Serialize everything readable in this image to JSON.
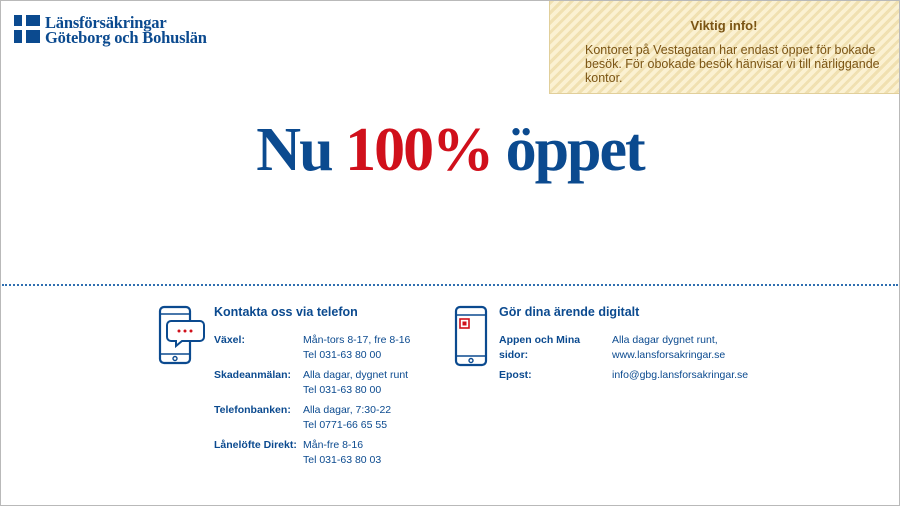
{
  "logo": {
    "line1": "Länsförsäkringar",
    "line2": "Göteborg och Bohuslän",
    "colors": {
      "blue": "#0b4a8f",
      "white": "#ffffff"
    }
  },
  "info": {
    "title": "Viktig info!",
    "body": "Kontoret på Vestagatan har endast öppet för bokade besök. För obokade besök hänvisar vi till närliggande kontor."
  },
  "headline": {
    "part1": "Nu ",
    "part2": "100%",
    "part3": " öppet",
    "colors": {
      "blue": "#0b4a8f",
      "red": "#d0101b"
    }
  },
  "phone_contact": {
    "title": "Kontakta oss via telefon",
    "icon": "phone-chat-icon",
    "rows": [
      {
        "label": "Växel:",
        "line1": "Mån-tors 8-17, fre 8-16",
        "line2": "Tel 031-63 80 00"
      },
      {
        "label": "Skadeanmälan:",
        "line1": "Alla dagar, dygnet runt",
        "line2": "Tel 031-63 80 00"
      },
      {
        "label": "Telefonbanken:",
        "line1": "Alla dagar, 7:30-22",
        "line2": "Tel 0771-66 65 55"
      },
      {
        "label": "Lånelöfte Direkt:",
        "line1": "Mån-fre 8-16",
        "line2": "Tel 031-63 80 03"
      }
    ]
  },
  "digital_contact": {
    "title": "Gör dina ärende digitalt",
    "icon": "smartphone-app-icon",
    "rows": [
      {
        "label": "Appen och Mina sidor:",
        "line1": "Alla dagar dygnet runt,",
        "line2": "www.lansforsakringar.se"
      },
      {
        "label": "Epost:",
        "line1": "info@gbg.lansforsakringar.se",
        "line2": ""
      }
    ]
  }
}
